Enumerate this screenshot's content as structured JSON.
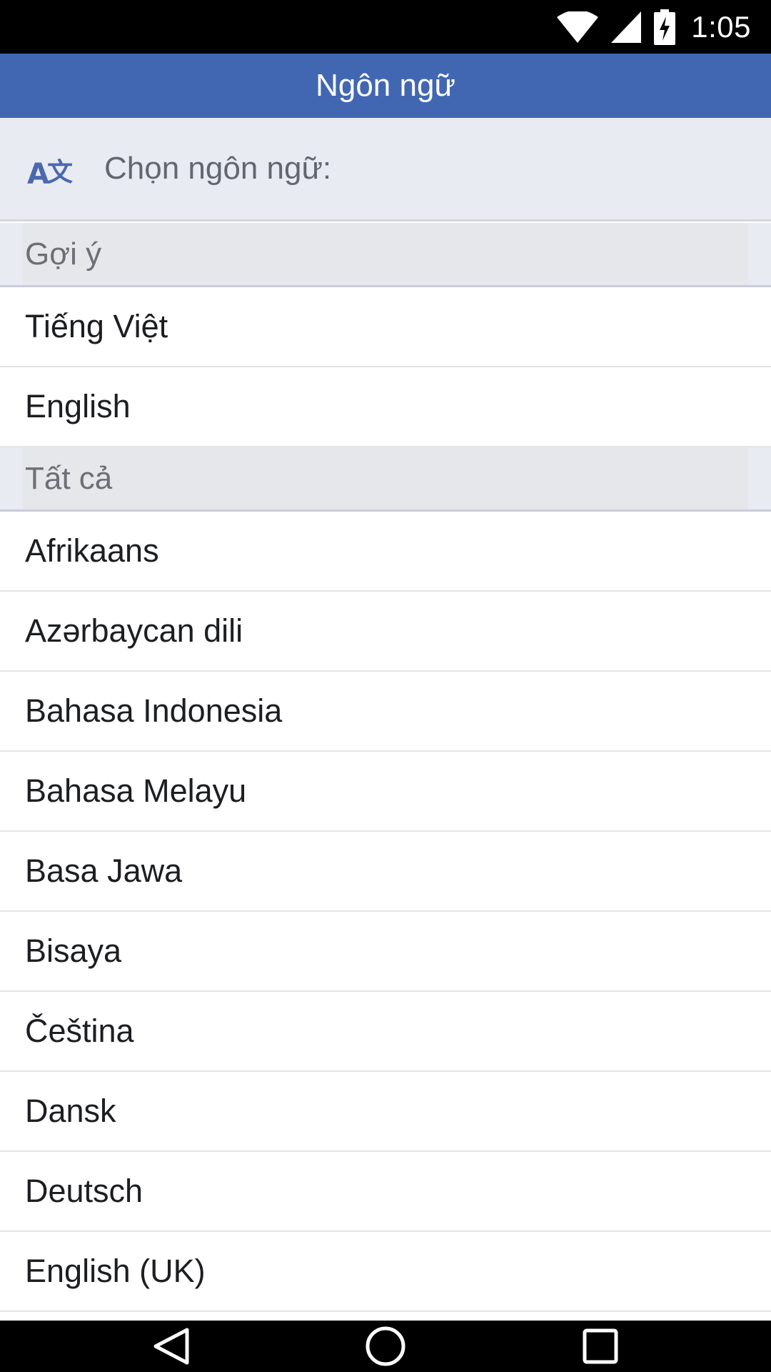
{
  "status_bar": {
    "time": "1:05",
    "icons": [
      "wifi-icon",
      "cellular-signal-icon",
      "battery-charging-icon"
    ]
  },
  "app_bar": {
    "title": "Ngôn ngữ"
  },
  "prompt": {
    "icon": "translate-icon",
    "text": "Chọn ngôn ngữ:"
  },
  "suggested": {
    "header": "Gợi ý",
    "items": [
      "Tiếng Việt",
      "English"
    ]
  },
  "all": {
    "header": "Tất cả",
    "items": [
      "Afrikaans",
      "Azərbaycan dili",
      "Bahasa Indonesia",
      "Bahasa Melayu",
      "Basa Jawa",
      "Bisaya",
      "Čeština",
      "Dansk",
      "Deutsch",
      "English (UK)"
    ]
  },
  "nav_bar": {
    "buttons": [
      "back-icon",
      "home-icon",
      "recents-icon"
    ]
  },
  "colors": {
    "brand": "#4267b2",
    "header_bg": "#e9ebf2"
  }
}
